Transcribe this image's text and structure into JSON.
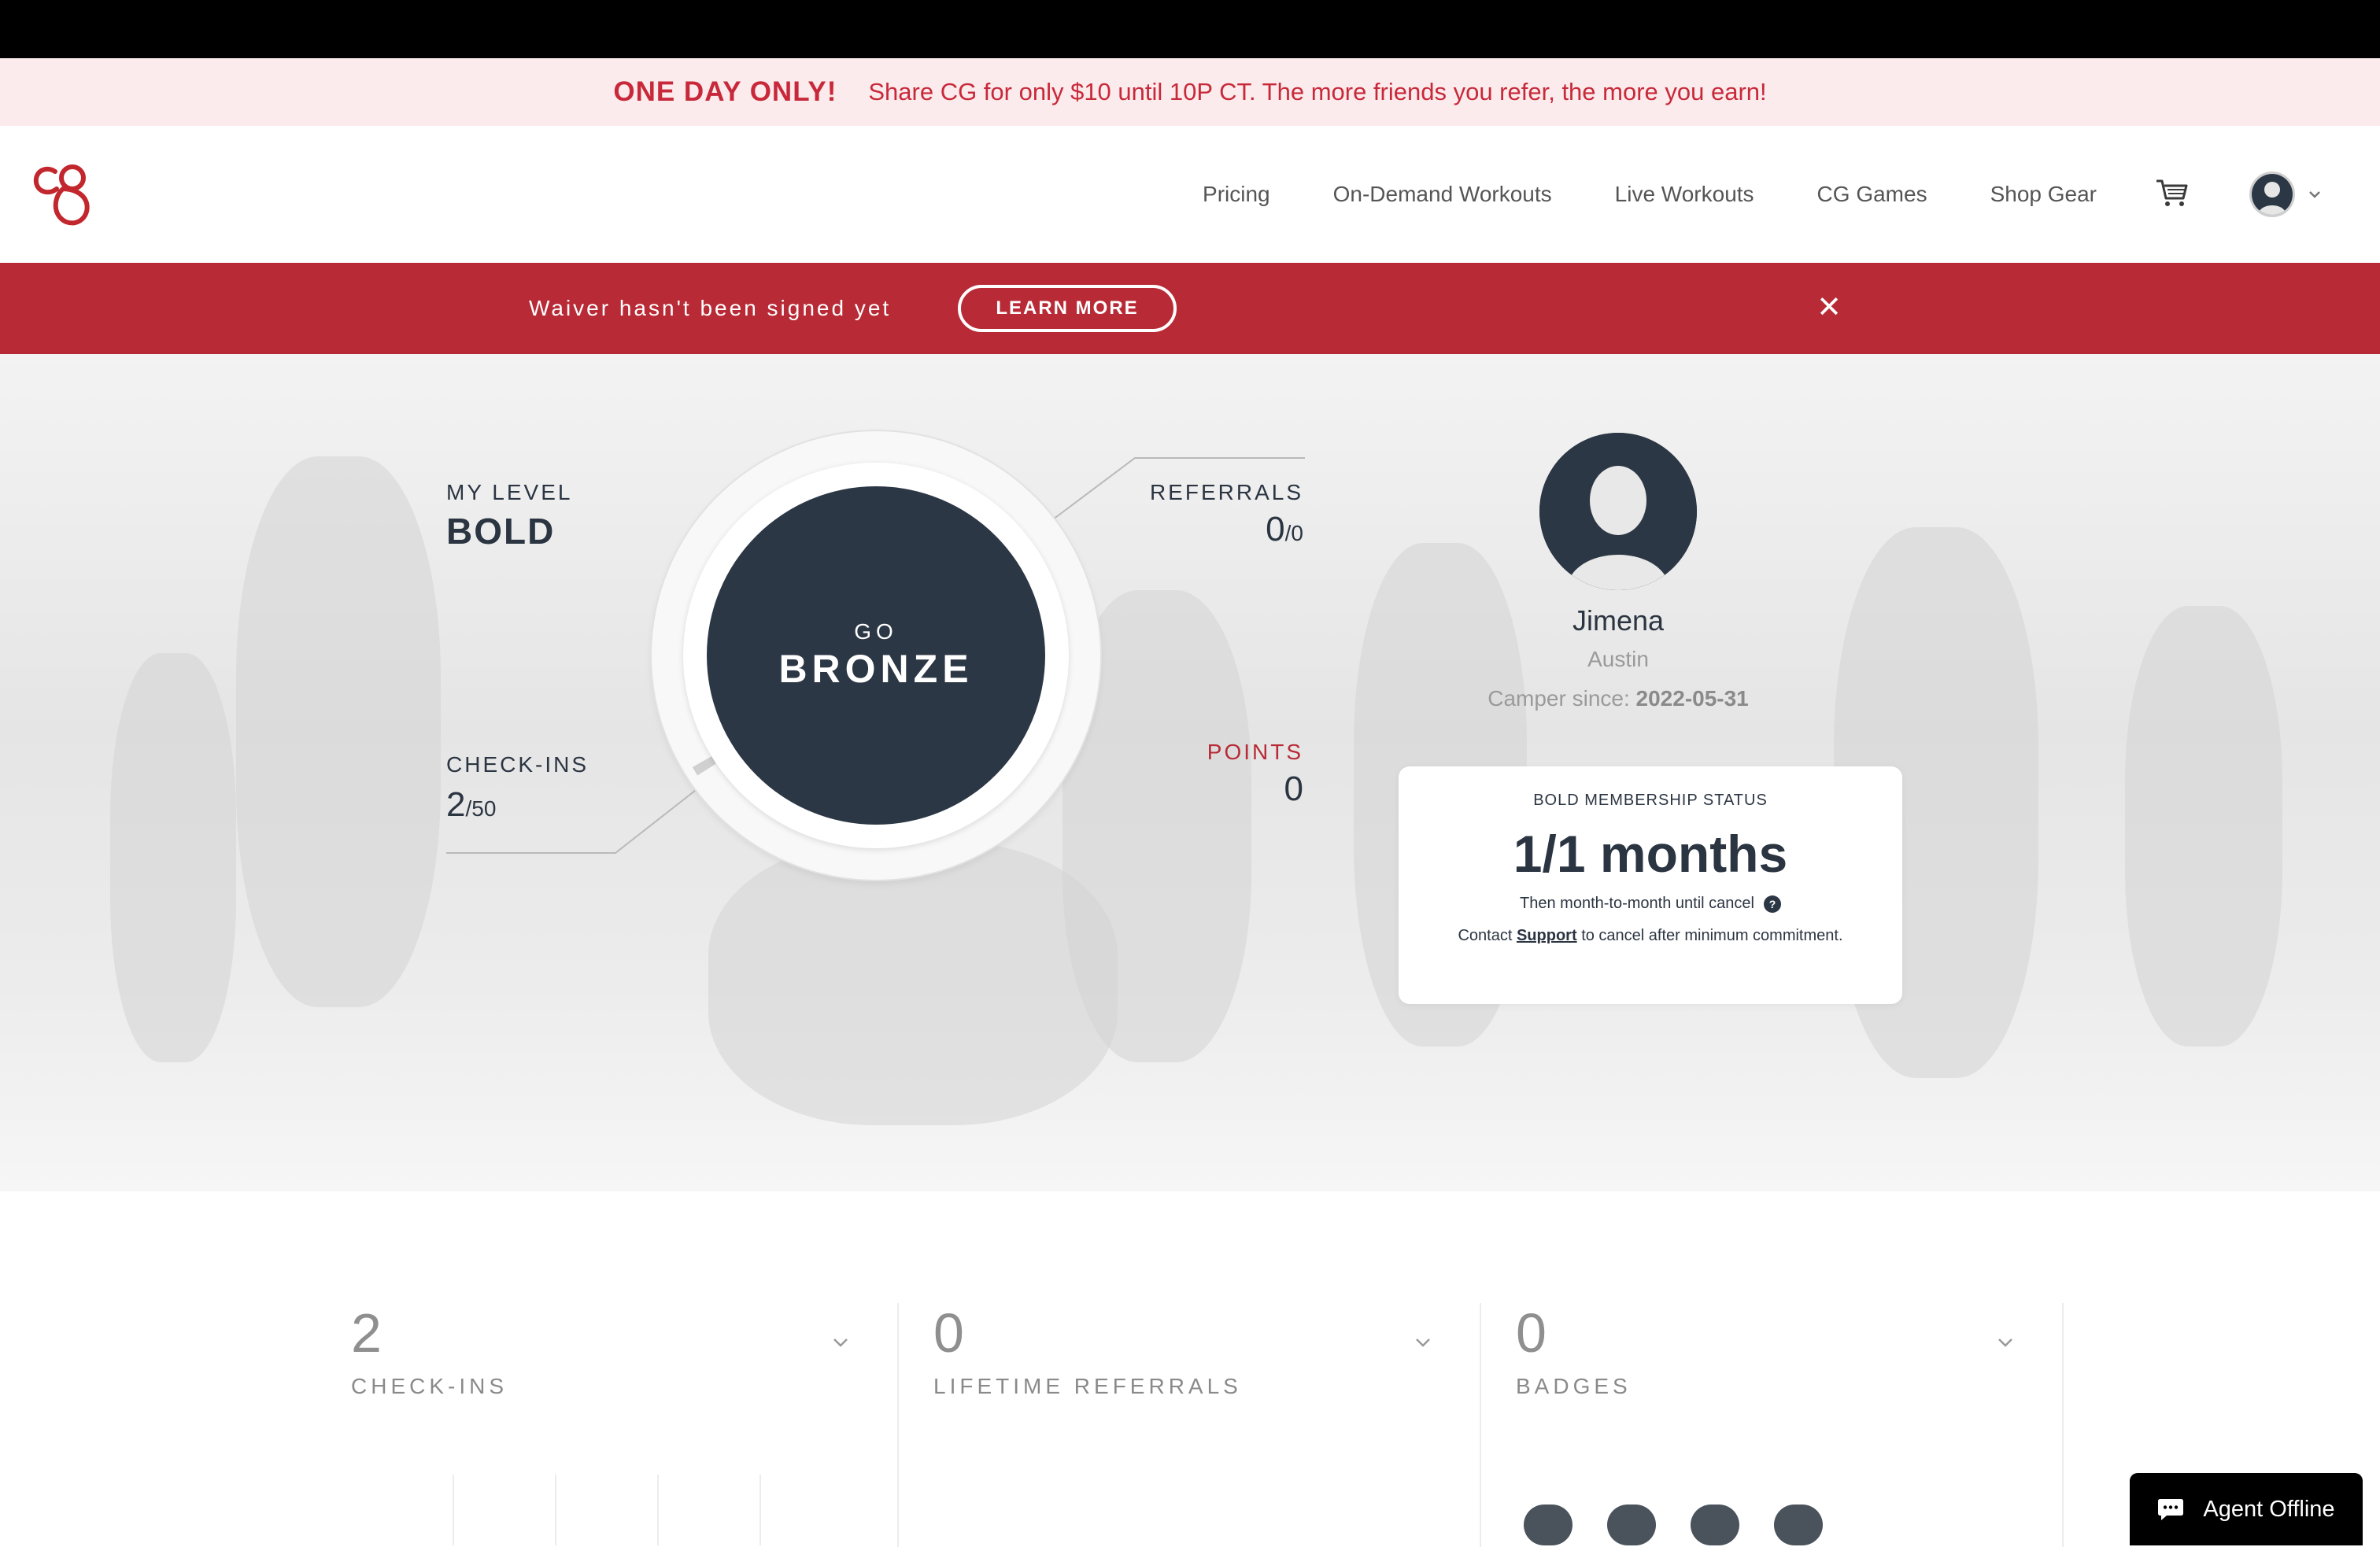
{
  "promo": {
    "headline": "ONE DAY ONLY!",
    "message": "Share CG for only $10 until 10P CT. The more friends you refer, the more you earn!"
  },
  "nav": {
    "logo_icon": "cg-logo-icon",
    "links": [
      "Pricing",
      "On-Demand Workouts",
      "Live Workouts",
      "CG Games",
      "Shop Gear"
    ],
    "cart_icon": "cart-icon",
    "account_icon": "avatar-icon"
  },
  "waiver": {
    "text": "Waiver hasn't been signed yet",
    "button": "LEARN MORE",
    "close": "✕"
  },
  "colors": {
    "brand_red": "#b82a35",
    "dark_navy": "#2c3745"
  },
  "level": {
    "label": "MY LEVEL",
    "value": "BOLD"
  },
  "checkins": {
    "label": "CHECK-INS",
    "current": "2",
    "total": "/50"
  },
  "referrals": {
    "label": "REFERRALS",
    "current": "0",
    "total": "/0"
  },
  "points": {
    "label": "POINTS",
    "value": "0"
  },
  "badge": {
    "prefix": "GO",
    "tier": "BRONZE"
  },
  "profile": {
    "name": "Jimena",
    "city": "Austin",
    "since_label": "Camper since:",
    "since_date": "2022-05-31"
  },
  "membership": {
    "title": "BOLD MEMBERSHIP STATUS",
    "value": "1/1 months",
    "then": "Then month-to-month until cancel",
    "contact_prefix": "Contact",
    "contact_link": "Support",
    "contact_suffix": "to cancel after minimum commitment."
  },
  "stats": [
    {
      "value": "2",
      "label": "CHECK-INS"
    },
    {
      "value": "0",
      "label": "LIFETIME REFERRALS"
    },
    {
      "value": "0",
      "label": "BADGES"
    }
  ],
  "chat": {
    "label": "Agent Offline"
  }
}
